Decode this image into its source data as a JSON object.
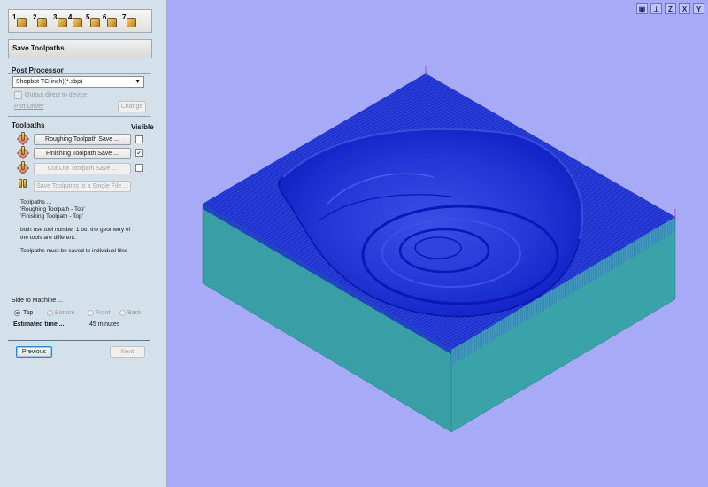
{
  "toolbar": {
    "steps": [
      {
        "num": "1",
        "icon": "setup-job-icon"
      },
      {
        "num": "2",
        "icon": "import-model-icon"
      },
      {
        "num": "3",
        "icon": "orient-model-icon"
      },
      {
        "num": "4",
        "icon": "model-size-icon"
      },
      {
        "num": "5",
        "icon": "machining-limit-icon"
      },
      {
        "num": "6",
        "icon": "toolpath-icon"
      },
      {
        "num": "7",
        "icon": "save-toolpath-icon"
      }
    ]
  },
  "panel": {
    "title": "Save Toolpaths"
  },
  "post_processor": {
    "heading": "Post Processor",
    "selected": "Shopbot TC(inch)(*.sbp)",
    "output_direct_label": "Output direct to device",
    "port_driver_label": "Port Driver",
    "change_label": "Change"
  },
  "toolpaths": {
    "heading": "Toolpaths",
    "visible_heading": "Visible",
    "items": [
      {
        "label": "Roughing Toolpath Save ...",
        "enabled": true,
        "visible": false
      },
      {
        "label": "Finishing Toolpath Save ...",
        "enabled": true,
        "visible": true
      },
      {
        "label": "Cut Out Toolpath Save ...",
        "enabled": false,
        "visible": false
      }
    ],
    "single_file_label": "Save Toolpaths to a Single File ..."
  },
  "info": {
    "lines": [
      "Toolpaths ...",
      "   'Roughing Toolpath - Top'",
      "   'Finishing Toolpath  - Top'",
      "",
      "both use  tool number 1 but the geometry of",
      "the tools are different.",
      "",
      "Toolpaths must be saved to individual files"
    ]
  },
  "side": {
    "heading": "Side to Machine ...",
    "options": [
      {
        "label": "Top",
        "selected": true,
        "enabled": true
      },
      {
        "label": "Bottom",
        "selected": false,
        "enabled": false
      },
      {
        "label": "Front",
        "selected": false,
        "enabled": false
      },
      {
        "label": "Back",
        "selected": false,
        "enabled": false
      }
    ],
    "estimated_label": "Estimated time ...",
    "estimated_value": "45 minutes"
  },
  "nav": {
    "previous_label": "Previous",
    "next_label": "Next"
  },
  "view_icons": [
    {
      "glyph": "▣",
      "name": "zoom-fit-icon"
    },
    {
      "glyph": "⊥",
      "name": "iso-view-icon"
    },
    {
      "glyph": "Z",
      "name": "view-z-icon"
    },
    {
      "glyph": "X",
      "name": "view-x-icon"
    },
    {
      "glyph": "Y",
      "name": "view-y-icon"
    }
  ],
  "colors": {
    "viewport_bg": "#a7aaf6",
    "block_side": "#3a9ea6",
    "block_top": "#1a2ec8",
    "toolpath": "#0b1ad8"
  }
}
